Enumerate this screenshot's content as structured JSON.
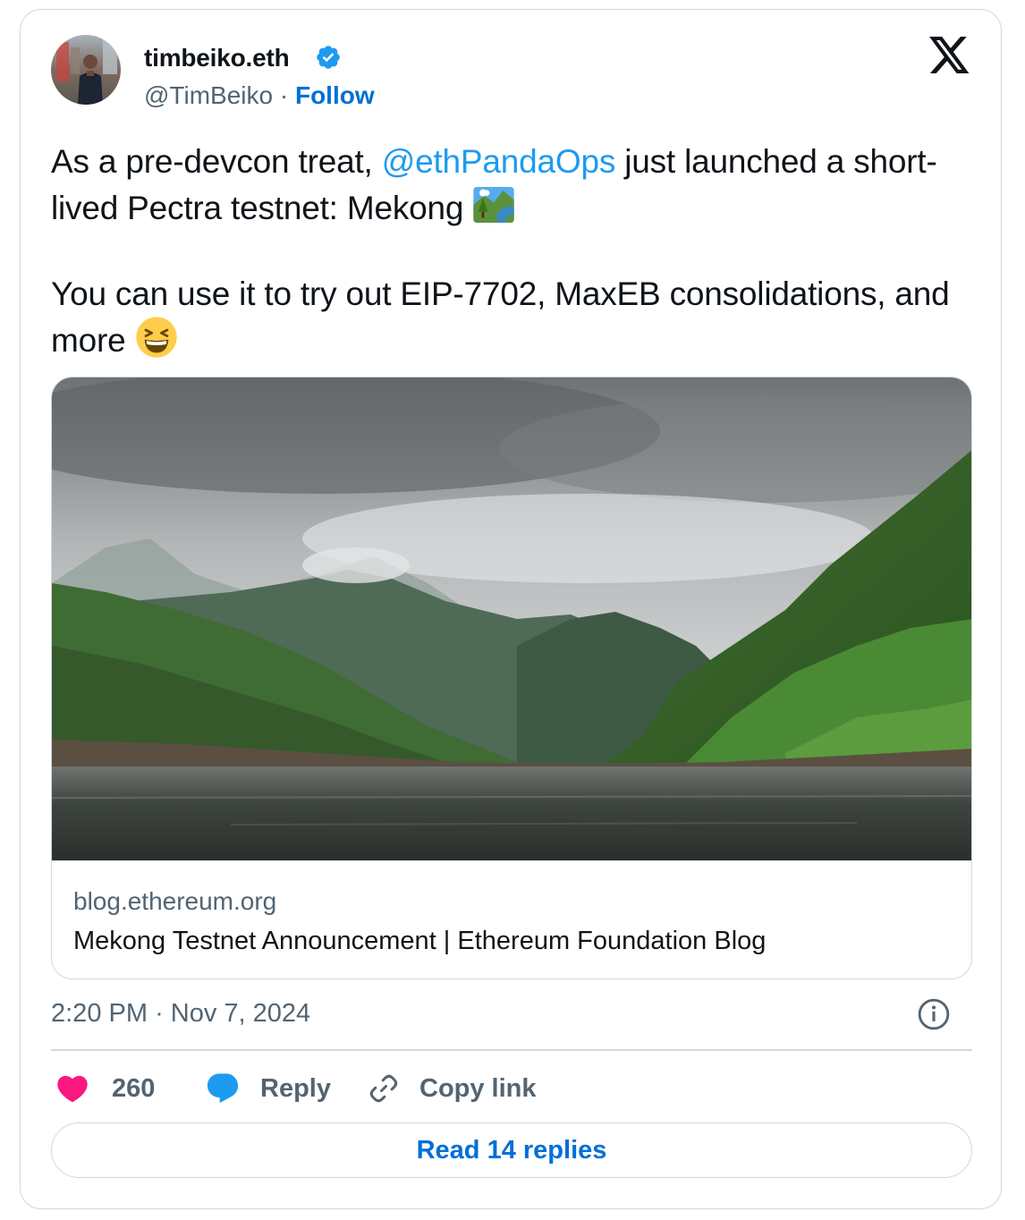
{
  "author": {
    "display_name": "timbeiko.eth",
    "handle": "@TimBeiko",
    "separator": "·",
    "follow_label": "Follow",
    "verified": true,
    "avatar_icon": "avatar"
  },
  "tweet": {
    "text_before_mention": "As a pre-devcon treat, ",
    "mention": "@ethPandaOps",
    "text_after_mention": " just launched a short-lived Pectra testnet: Mekong ",
    "emoji_1": "national-park-emoji",
    "line_2": "You can use it to try out EIP-7702, MaxEB consolidations, and more ",
    "emoji_2": "grinning-squinting-face-emoji"
  },
  "link_card": {
    "domain": "blog.ethereum.org",
    "title": "Mekong Testnet Announcement | Ethereum Foundation Blog",
    "image": "river-mountains-photo"
  },
  "meta": {
    "time": "2:20 PM",
    "separator": "·",
    "date": "Nov 7, 2024"
  },
  "actions": {
    "likes": "260",
    "reply_label": "Reply",
    "copy_link_label": "Copy link",
    "read_replies_label": "Read 14 replies"
  },
  "colors": {
    "accent": "#006fd6",
    "mention": "#1d9bf0",
    "like": "#f91880",
    "reply_icon": "#1d9bf0",
    "secondary_text": "#536471",
    "border": "#cfd9de"
  }
}
